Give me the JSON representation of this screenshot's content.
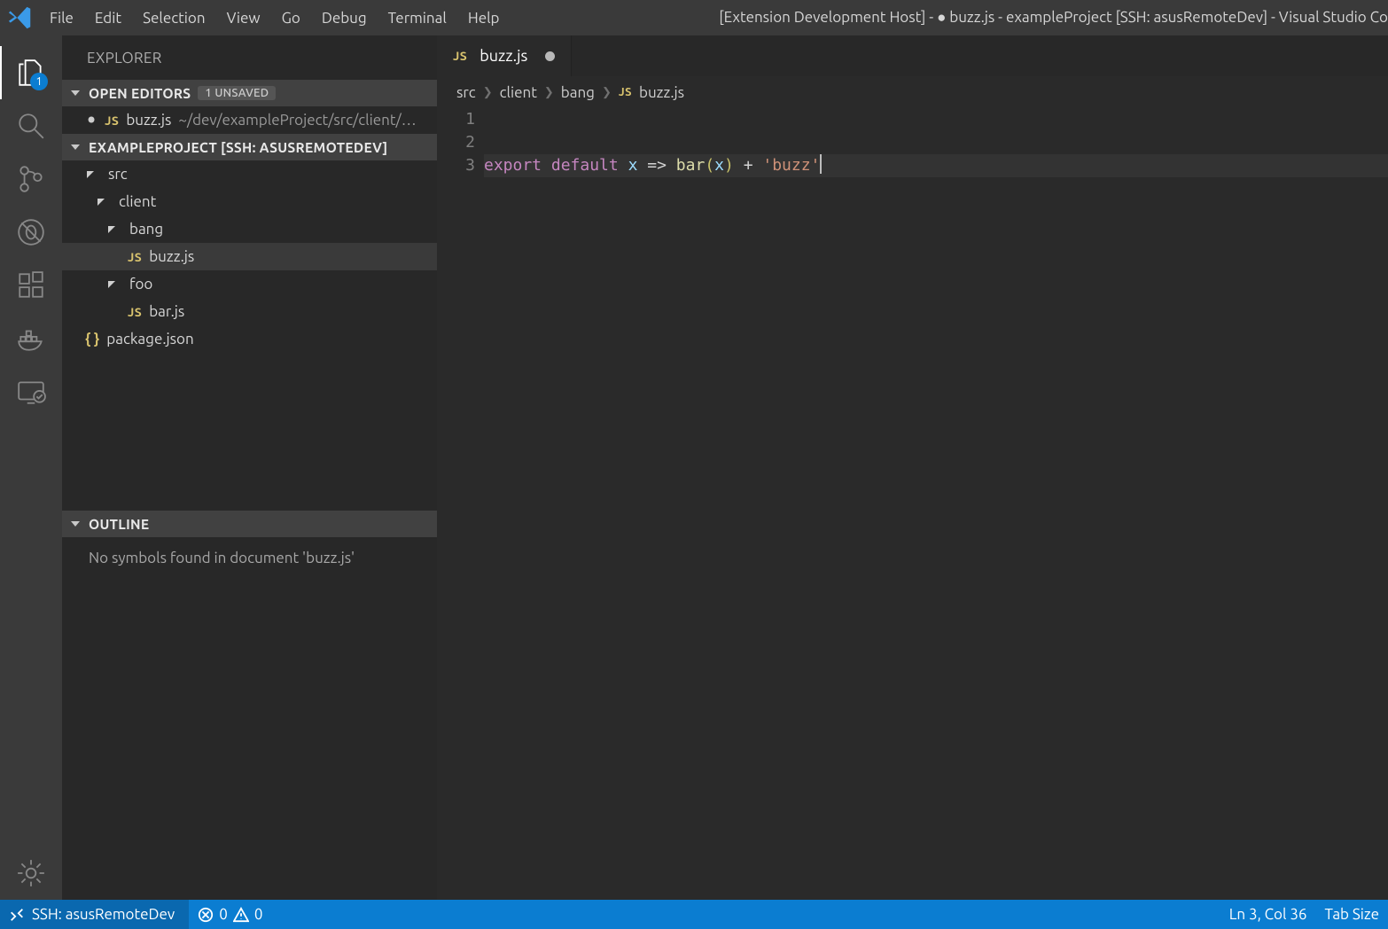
{
  "titlebar": {
    "menu": [
      "File",
      "Edit",
      "Selection",
      "View",
      "Go",
      "Debug",
      "Terminal",
      "Help"
    ],
    "title": "[Extension Development Host] - ● buzz.js - exampleProject [SSH: asusRemoteDev] - Visual Studio Co"
  },
  "activitybar": {
    "badge": "1"
  },
  "sidebar": {
    "title": "EXPLORER",
    "openEditors": {
      "label": "OPEN EDITORS",
      "badge": "1 UNSAVED",
      "items": [
        {
          "icon": "JS",
          "name": "buzz.js",
          "path": "~/dev/exampleProject/src/client/…",
          "dirty": true
        }
      ]
    },
    "project": {
      "label": "EXAMPLEPROJECT [SSH: ASUSREMOTEDEV]",
      "tree": {
        "src": {
          "client": {
            "bang": {
              "buzz_js": "buzz.js"
            },
            "foo": {
              "bar_js": "bar.js"
            }
          }
        },
        "package_json": "package.json"
      }
    },
    "outline": {
      "label": "OUTLINE",
      "message": "No symbols found in document 'buzz.js'"
    }
  },
  "tabs": [
    {
      "icon": "JS",
      "name": "buzz.js",
      "dirty": true
    }
  ],
  "breadcrumbs": [
    "src",
    "client",
    "bang",
    "buzz.js"
  ],
  "code": {
    "line_numbers": [
      "1",
      "2",
      "3"
    ],
    "line3": {
      "kw_export": "export",
      "kw_default": "default",
      "var_x": "x",
      "arrow": "=>",
      "fn_bar": "bar",
      "l": "(",
      "arg": "x",
      "r": ")",
      "plus": "+",
      "str": "'buzz'"
    }
  },
  "statusbar": {
    "remote": "SSH: asusRemoteDev",
    "errors": "0",
    "warnings": "0",
    "cursor": "Ln 3, Col 36",
    "tabsize": "Tab Size"
  }
}
